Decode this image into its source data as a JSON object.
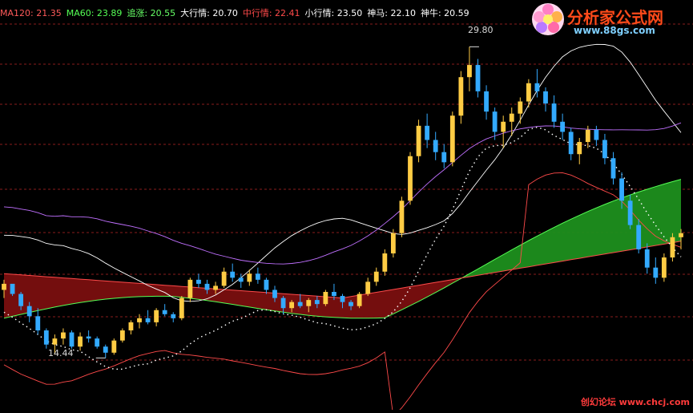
{
  "legend": [
    {
      "label": "MA120: 21.35",
      "color": "#ff5a5a"
    },
    {
      "label": "MA60: 23.89",
      "color": "#55ff55"
    },
    {
      "label": "追涨: 20.55",
      "color": "#66ff66"
    },
    {
      "label": "大行情: 20.70",
      "color": "#ffffff"
    },
    {
      "label": "中行情: 22.41",
      "color": "#ff4a4a"
    },
    {
      "label": "小行情: 23.50",
      "color": "#ffffff"
    },
    {
      "label": "神马: 22.10",
      "color": "#ffffff"
    },
    {
      "label": "神牛: 20.59",
      "color": "#ffffff"
    }
  ],
  "logo": {
    "title": "分析家公式网",
    "url": "www.88gs.com"
  },
  "watermark": "创幻论坛 www.chcj.com",
  "chart_data": {
    "type": "candlestick",
    "title": "",
    "ylim": [
      12.0,
      31.0
    ],
    "high_label": "29.80",
    "low_label": "14.44",
    "grid": "dashed horizontal",
    "candles": [
      [
        17.8,
        18.3,
        17.4,
        18.1
      ],
      [
        18.1,
        18.0,
        17.5,
        17.6
      ],
      [
        17.6,
        17.7,
        16.8,
        17.0
      ],
      [
        17.0,
        17.2,
        16.2,
        16.5
      ],
      [
        16.5,
        16.9,
        15.6,
        15.8
      ],
      [
        15.8,
        15.9,
        14.9,
        15.1
      ],
      [
        15.1,
        15.6,
        14.6,
        15.4
      ],
      [
        15.4,
        15.9,
        15.1,
        15.7
      ],
      [
        15.7,
        15.8,
        14.9,
        15.0
      ],
      [
        15.0,
        15.7,
        14.8,
        15.5
      ],
      [
        15.5,
        15.8,
        15.2,
        15.4
      ],
      [
        15.4,
        15.5,
        14.9,
        15.0
      ],
      [
        15.0,
        15.1,
        14.44,
        14.7
      ],
      [
        14.7,
        15.4,
        14.6,
        15.3
      ],
      [
        15.3,
        15.9,
        15.2,
        15.8
      ],
      [
        15.8,
        16.3,
        15.6,
        16.2
      ],
      [
        16.2,
        16.6,
        15.9,
        16.4
      ],
      [
        16.4,
        16.8,
        16.1,
        16.2
      ],
      [
        16.2,
        16.9,
        16.0,
        16.8
      ],
      [
        16.8,
        17.1,
        16.5,
        16.6
      ],
      [
        16.6,
        16.7,
        16.2,
        16.4
      ],
      [
        16.4,
        17.5,
        16.3,
        17.4
      ],
      [
        17.4,
        18.4,
        17.2,
        18.3
      ],
      [
        18.3,
        18.6,
        17.9,
        18.1
      ],
      [
        18.1,
        18.3,
        17.6,
        17.8
      ],
      [
        17.8,
        18.2,
        17.6,
        18.0
      ],
      [
        18.0,
        18.9,
        17.9,
        18.7
      ],
      [
        18.7,
        19.1,
        18.2,
        18.4
      ],
      [
        18.4,
        18.6,
        17.9,
        18.2
      ],
      [
        18.2,
        18.8,
        18.0,
        18.6
      ],
      [
        18.6,
        18.9,
        18.1,
        18.3
      ],
      [
        18.3,
        18.4,
        17.6,
        17.8
      ],
      [
        17.8,
        18.0,
        17.2,
        17.4
      ],
      [
        17.4,
        17.5,
        16.6,
        16.9
      ],
      [
        16.9,
        17.3,
        16.7,
        17.2
      ],
      [
        17.2,
        17.6,
        16.9,
        17.0
      ],
      [
        17.0,
        17.4,
        16.7,
        17.3
      ],
      [
        17.3,
        17.5,
        16.9,
        17.1
      ],
      [
        17.1,
        17.8,
        17.0,
        17.7
      ],
      [
        17.7,
        18.1,
        17.3,
        17.5
      ],
      [
        17.5,
        17.6,
        16.9,
        17.2
      ],
      [
        17.2,
        17.3,
        16.8,
        17.0
      ],
      [
        17.0,
        17.7,
        16.9,
        17.6
      ],
      [
        17.6,
        18.4,
        17.5,
        18.2
      ],
      [
        18.2,
        18.9,
        18.0,
        18.7
      ],
      [
        18.7,
        19.8,
        18.5,
        19.6
      ],
      [
        19.6,
        20.8,
        19.4,
        20.6
      ],
      [
        20.6,
        22.4,
        20.4,
        22.2
      ],
      [
        22.2,
        24.6,
        22.0,
        24.4
      ],
      [
        24.4,
        26.2,
        24.1,
        25.9
      ],
      [
        25.9,
        26.5,
        24.8,
        25.2
      ],
      [
        25.2,
        25.6,
        24.2,
        24.6
      ],
      [
        24.6,
        25.0,
        23.8,
        24.1
      ],
      [
        24.1,
        26.6,
        23.9,
        26.4
      ],
      [
        26.4,
        28.6,
        26.0,
        28.3
      ],
      [
        28.3,
        29.8,
        27.6,
        28.9
      ],
      [
        28.9,
        29.2,
        27.3,
        27.6
      ],
      [
        27.6,
        27.9,
        26.2,
        26.6
      ],
      [
        26.6,
        26.8,
        25.2,
        25.6
      ],
      [
        25.6,
        26.4,
        24.8,
        26.1
      ],
      [
        26.1,
        26.8,
        25.4,
        26.5
      ],
      [
        26.5,
        27.3,
        26.0,
        27.1
      ],
      [
        27.1,
        28.2,
        26.8,
        28.0
      ],
      [
        28.0,
        28.7,
        27.3,
        27.6
      ],
      [
        27.6,
        27.8,
        26.6,
        27.0
      ],
      [
        27.0,
        27.4,
        25.8,
        26.1
      ],
      [
        26.1,
        26.5,
        25.2,
        25.6
      ],
      [
        25.6,
        25.8,
        24.2,
        24.5
      ],
      [
        24.5,
        25.3,
        24.0,
        25.1
      ],
      [
        25.1,
        25.9,
        24.8,
        25.7
      ],
      [
        25.7,
        25.9,
        24.9,
        25.2
      ],
      [
        25.2,
        25.5,
        24.0,
        24.3
      ],
      [
        24.3,
        24.6,
        23.0,
        23.3
      ],
      [
        23.3,
        23.6,
        21.8,
        22.2
      ],
      [
        22.2,
        22.5,
        20.8,
        21.0
      ],
      [
        21.0,
        21.3,
        19.6,
        19.8
      ],
      [
        19.8,
        20.1,
        18.6,
        18.9
      ],
      [
        18.9,
        19.4,
        18.1,
        18.4
      ],
      [
        18.4,
        19.6,
        18.2,
        19.4
      ],
      [
        19.4,
        20.6,
        19.2,
        20.4
      ],
      [
        20.4,
        20.8,
        19.8,
        20.6
      ]
    ],
    "overlay_lines": [
      {
        "name": "MA120",
        "color": "#ff4a4a",
        "style": "solid"
      },
      {
        "name": "MA60",
        "color": "#55ff55",
        "style": "solid"
      },
      {
        "name": "大行情",
        "color": "#ffffff",
        "style": "solid"
      },
      {
        "name": "中行情",
        "color": "#ff4a4a",
        "style": "solid"
      },
      {
        "name": "小行情",
        "color": "#ffffff",
        "style": "dotted"
      },
      {
        "name": "神马",
        "color": "#c070ff",
        "style": "solid"
      },
      {
        "name": "神牛",
        "color": "#ffffff",
        "style": "solid"
      }
    ]
  }
}
